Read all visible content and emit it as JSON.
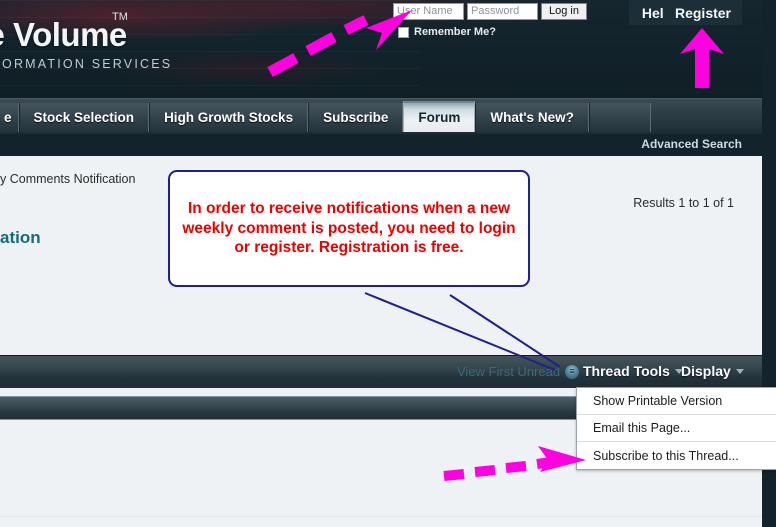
{
  "colors": {
    "accent_magenta": "#FF00E0",
    "callout_border": "#1F1F8F",
    "callout_text": "#EE0000",
    "header_bg": "#12232B",
    "page_bg": "#EFF2F5",
    "title_teal": "#166B79",
    "link_teal": "#3E6A7C"
  },
  "header": {
    "logo_main": "ive Volume",
    "logo_tm": "TM",
    "logo_sub": "T INFORMATION SERVICES",
    "login": {
      "username_placeholder": "User Name",
      "username_value": "",
      "password_placeholder": "Password",
      "password_value": "",
      "login_button": "Log in",
      "remember_label": "Remember Me?"
    },
    "help_button": "Help",
    "register_button": "Register"
  },
  "nav": {
    "tabs": [
      {
        "label": "e",
        "active": false
      },
      {
        "label": "Stock Selection",
        "active": false
      },
      {
        "label": "High Growth Stocks",
        "active": false
      },
      {
        "label": "Subscribe",
        "active": false
      },
      {
        "label": "Forum",
        "active": true
      },
      {
        "label": "What's New?",
        "active": false
      }
    ],
    "search_placeholder": "",
    "search_value": "",
    "search_icon": "magnifier-icon",
    "advanced_search": "Advanced Search"
  },
  "page": {
    "breadcrumb": "y Comments Notification",
    "title": "ation",
    "results_count": "Results 1 to 1 of 1"
  },
  "toolbar": {
    "view_first_unread": "View First Unread",
    "view_first_unread_icon": "unread-bubble-icon",
    "thread_tools": "Thread Tools",
    "display": "Display",
    "chevron_icon": "chevron-down-icon"
  },
  "dropdown": {
    "items": [
      "Show Printable Version",
      "Email this Page...",
      "Subscribe to this Thread..."
    ]
  },
  "callout": {
    "text": "In order to receive notifications when a new weekly comment is posted, you need to login or register. Registration is free."
  },
  "annotations": {
    "arrow_to_login": "dashed-arrow-up-right",
    "arrow_to_register": "solid-arrow-up",
    "arrow_to_subscribe": "dashed-arrow-right"
  }
}
